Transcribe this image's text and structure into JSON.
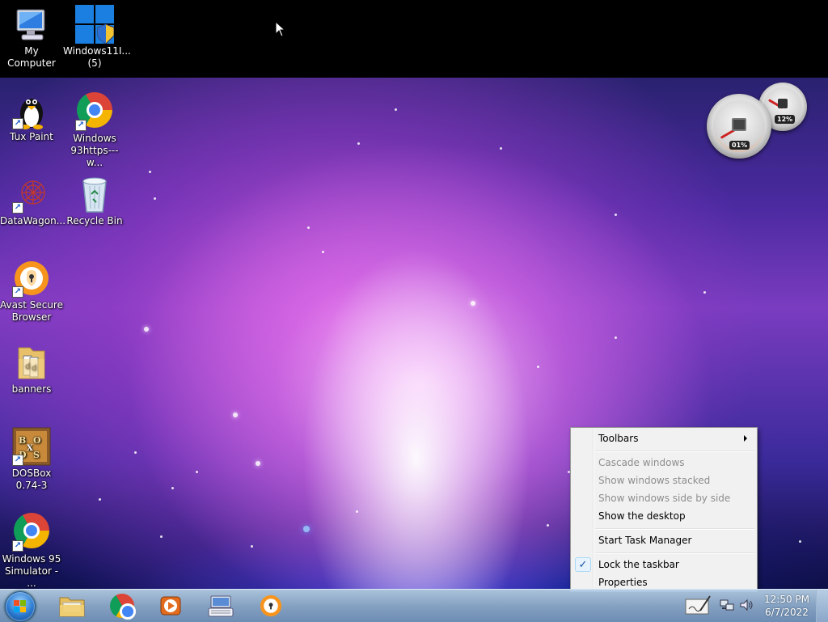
{
  "desktop": {
    "icons": [
      {
        "label": "My Computer",
        "icon": "computer-icon"
      },
      {
        "label": "Windows11I... (5)",
        "label_line1": "Windows11I...",
        "label_line2": "(5)",
        "icon": "windows-installer-icon"
      },
      {
        "label": "Tux Paint",
        "icon": "tux-penguin-icon",
        "shortcut": true
      },
      {
        "label": "Windows 93https---w...",
        "label_line1": "Windows",
        "label_line2": "93https---w...",
        "icon": "chrome-icon",
        "shortcut": true
      },
      {
        "label": "DataWagon...",
        "icon": "datawagon-icon",
        "shortcut": true
      },
      {
        "label": "Recycle Bin",
        "icon": "recycle-bin-icon"
      },
      {
        "label": "Avast Secure Browser",
        "label_line1": "Avast Secure",
        "label_line2": "Browser",
        "icon": "avast-browser-icon",
        "shortcut": true
      },
      {
        "label": "banners",
        "icon": "folder-icon"
      },
      {
        "label": "DOSBox 0.74-3",
        "label_line1": "DOSBox",
        "label_line2": "0.74-3",
        "icon": "dosbox-icon",
        "shortcut": true
      },
      {
        "label": "Windows 95 Simulator - ...",
        "label_line1": "Windows 95",
        "label_line2": "Simulator - ...",
        "icon": "chrome-icon",
        "shortcut": true
      }
    ]
  },
  "gadgets": {
    "cpu_meter": {
      "cpu_label": "01%",
      "memory_label": "12%"
    }
  },
  "context_menu": {
    "items": [
      {
        "label": "Toolbars",
        "enabled": true,
        "submenu": true
      },
      {
        "label": "Cascade windows",
        "enabled": false
      },
      {
        "label": "Show windows stacked",
        "enabled": false
      },
      {
        "label": "Show windows side by side",
        "enabled": false
      },
      {
        "label": "Show the desktop",
        "enabled": true
      },
      {
        "label": "Start Task Manager",
        "enabled": true
      },
      {
        "label": "Lock the taskbar",
        "enabled": true,
        "checked": true
      },
      {
        "label": "Properties",
        "enabled": true
      }
    ]
  },
  "taskbar": {
    "pinned": [
      "file-explorer-icon",
      "chrome-icon",
      "media-player-icon",
      "on-screen-keyboard-icon",
      "avast-browser-icon"
    ],
    "tray": [
      "handwriting-input-icon",
      "network-icon",
      "volume-icon"
    ],
    "clock": {
      "time": "12:50 PM",
      "date": "6/7/2022"
    }
  },
  "colors": {
    "menu_bg": "#f1f1f1",
    "disabled_text": "#8d8d8d",
    "taskbar": "#8caacd"
  }
}
